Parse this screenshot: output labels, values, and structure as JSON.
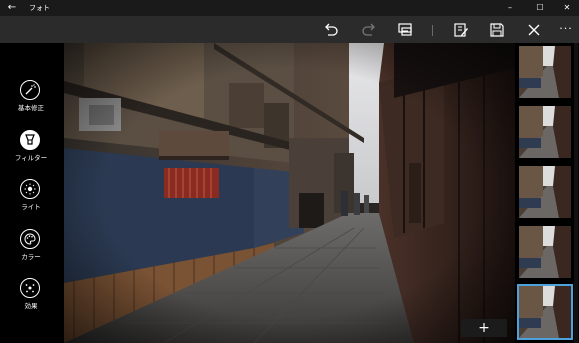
{
  "window": {
    "title": "フォト",
    "back_icon": "arrow-left-icon",
    "minimize": "–",
    "maximize": "☐",
    "close": "✕"
  },
  "toolbar": {
    "icons": [
      "undo-icon",
      "redo-icon",
      "compare-icon",
      "edit-icon",
      "save-icon",
      "close-icon"
    ],
    "more": "···"
  },
  "tools": [
    {
      "id": "basic",
      "label": "基本修正",
      "icon": "wand-icon",
      "active": false
    },
    {
      "id": "filter",
      "label": "フィルター",
      "icon": "filter-icon",
      "active": true
    },
    {
      "id": "light",
      "label": "ライト",
      "icon": "sun-icon",
      "active": false
    },
    {
      "id": "color",
      "label": "カラー",
      "icon": "palette-icon",
      "active": false
    },
    {
      "id": "effects",
      "label": "効果",
      "icon": "effects-icon",
      "active": false
    }
  ],
  "photo": {
    "add_button": "+"
  },
  "thumbnails": {
    "count": 5,
    "selected_index": 4
  },
  "colors": {
    "accent": "#4ea2d9",
    "titlebar": "#1a1a1a",
    "commandbar": "#2b2b2b"
  }
}
